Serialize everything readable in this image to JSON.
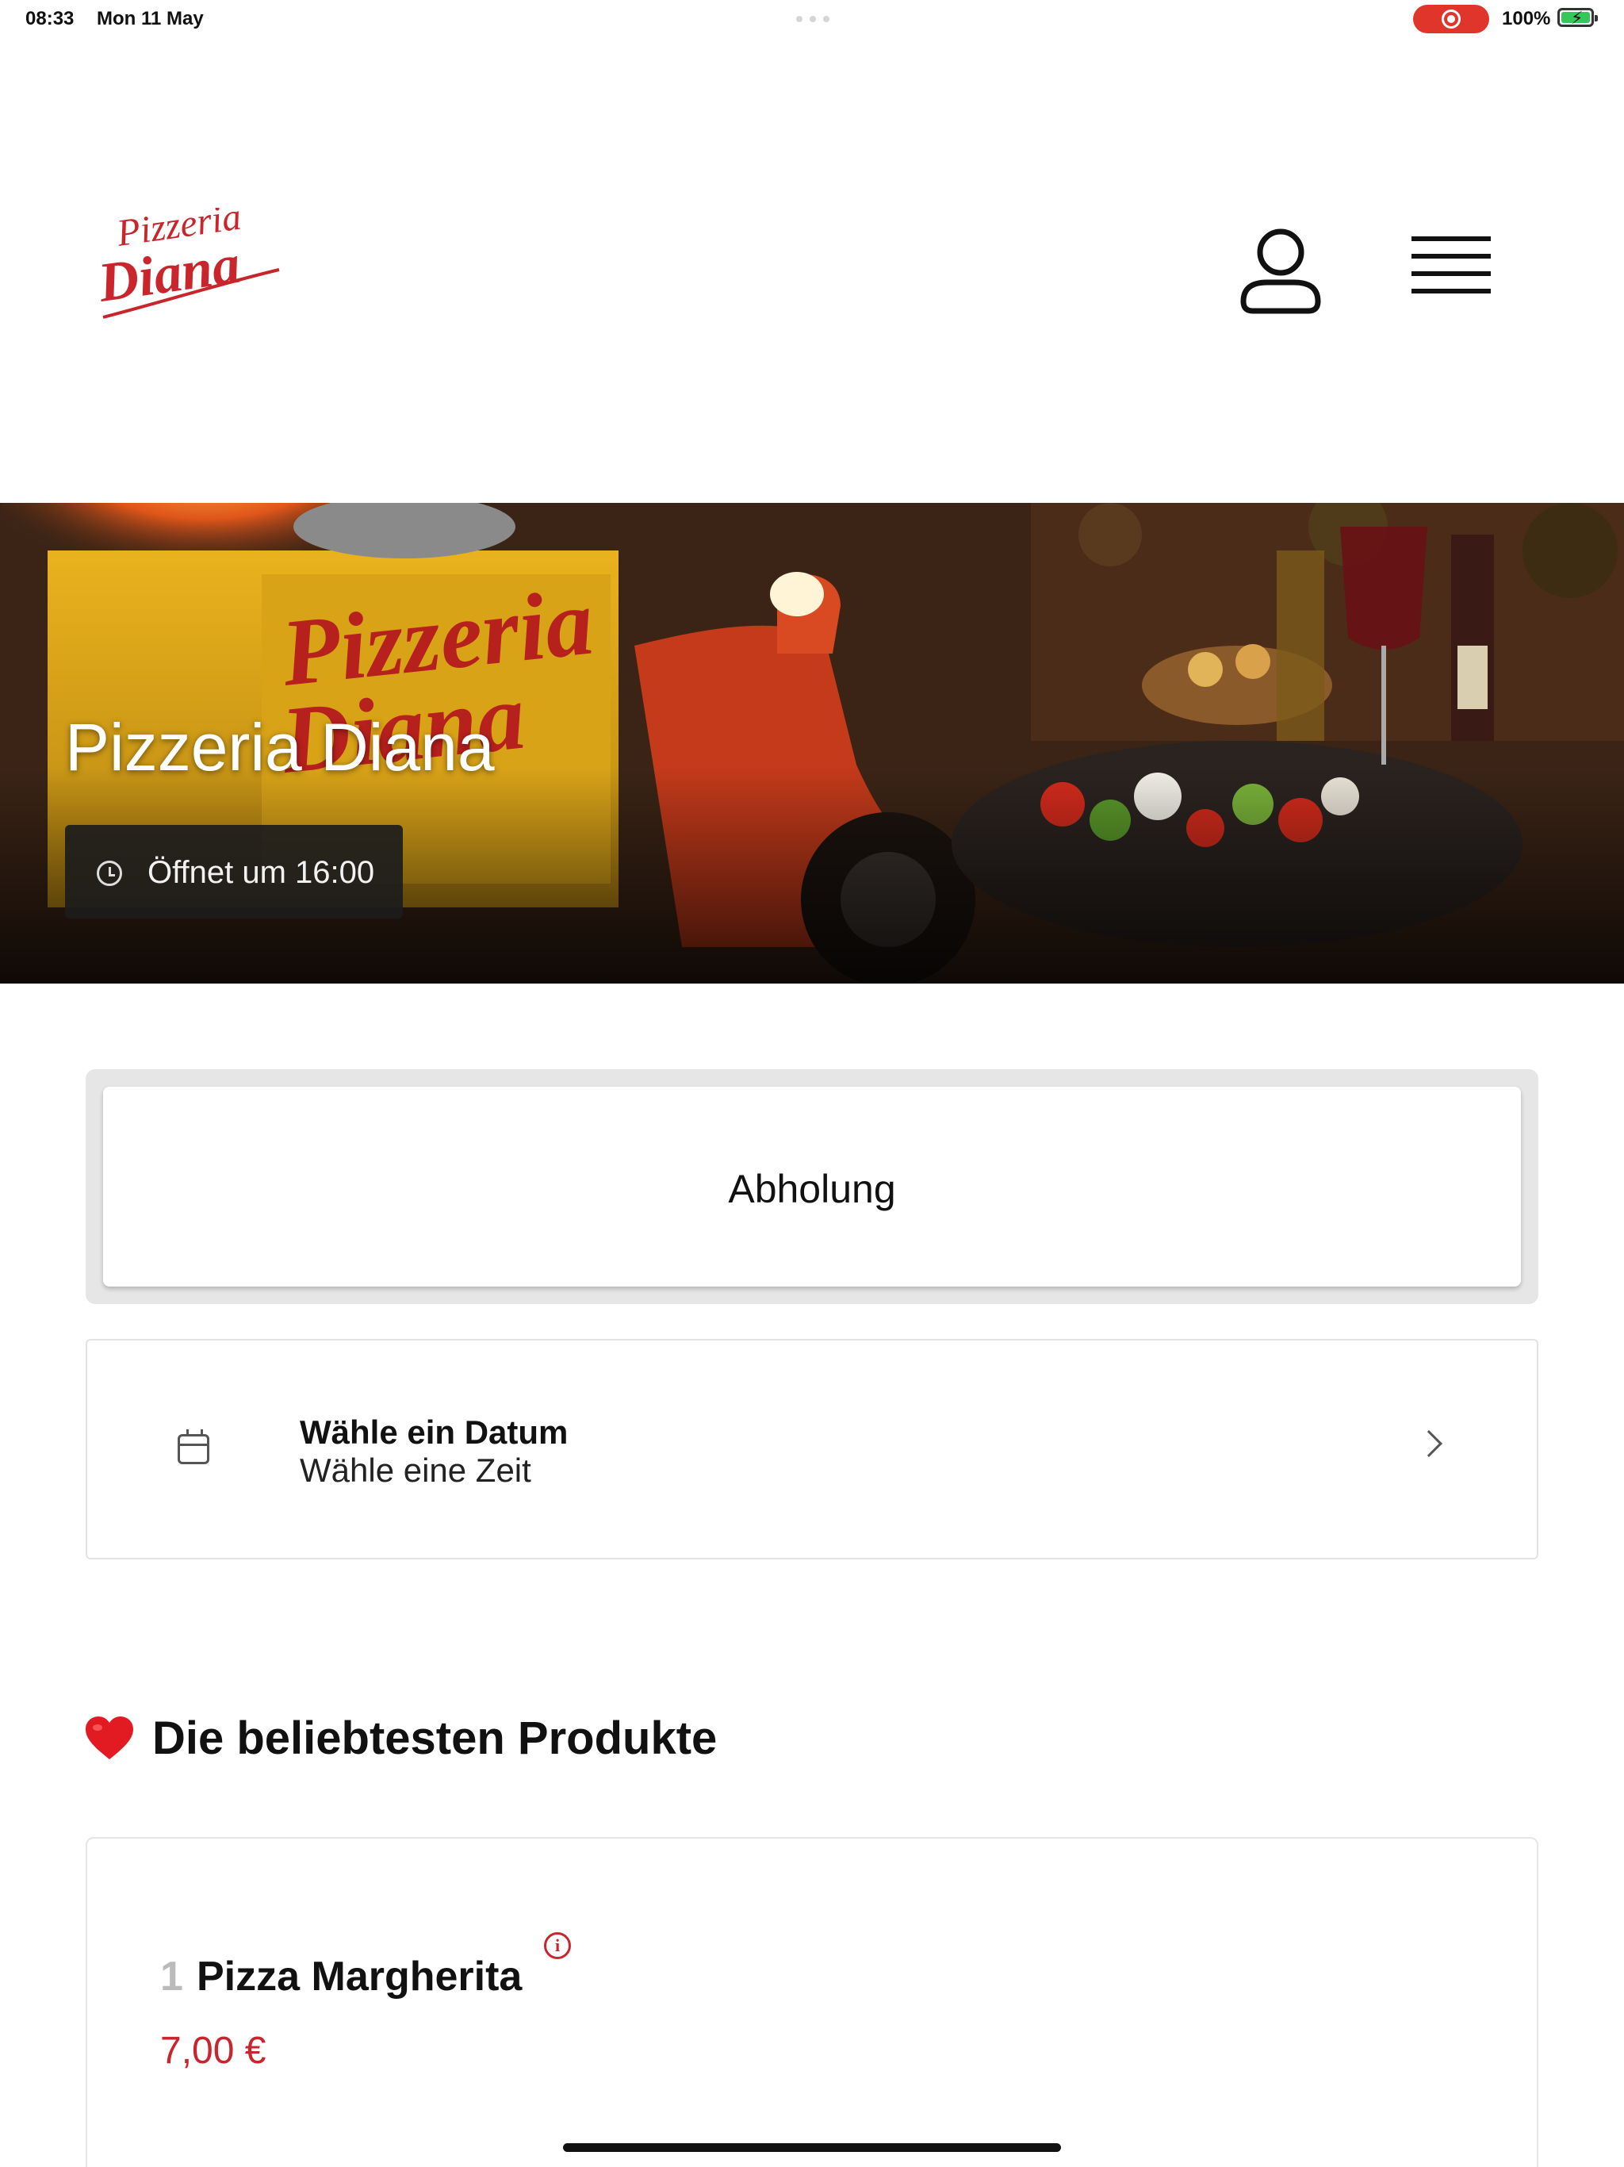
{
  "status_bar": {
    "time": "08:33",
    "date": "Mon 11 May",
    "battery": "100%",
    "record_color": "#e0352b"
  },
  "header": {
    "logo_text_line1": "Pizzeria",
    "logo_text_line2": "Diana",
    "logo_color": "#c8262c",
    "profile_icon": "user-icon",
    "menu_icon": "hamburger-menu-icon"
  },
  "hero": {
    "title": "Pizzeria Diana",
    "opening_status": "Öffnet um 16:00",
    "box_text": "Pizzeria Diana"
  },
  "order": {
    "mode_label": "Abholung",
    "date_title": "Wähle ein Datum",
    "time_subtitle": "Wähle eine Zeit"
  },
  "popular": {
    "heading": "Die beliebtesten Produkte",
    "heading_emoji": "heart-icon",
    "products": [
      {
        "rank": "1",
        "name": "Pizza Margherita",
        "price": "7,00 €"
      }
    ]
  },
  "colors": {
    "accent": "#c8262c",
    "toggle_bg": "#e6e6e6"
  }
}
